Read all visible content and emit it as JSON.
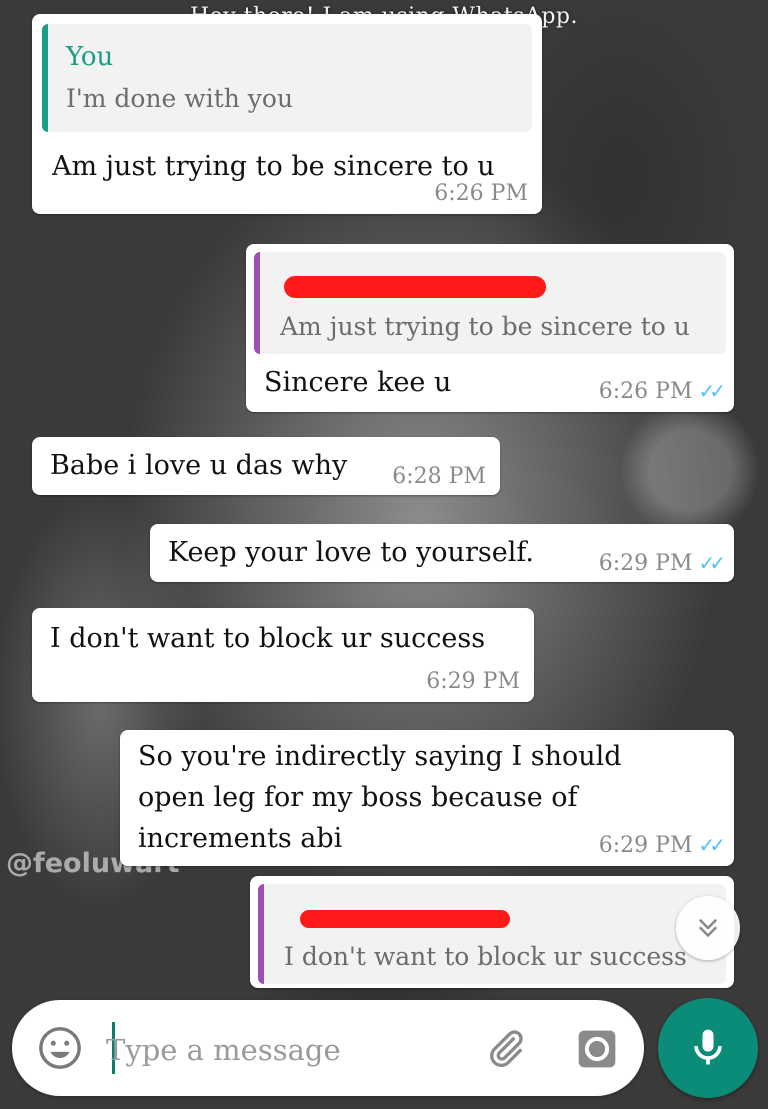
{
  "header": {
    "status": "Hey there! I am using WhatsApp."
  },
  "watermark": "@feoluwart",
  "messages": [
    {
      "direction": "in",
      "quote": {
        "author": "You",
        "text": "I'm done with you"
      },
      "text": "Am just trying to be sincere to u",
      "time": "6:26 PM"
    },
    {
      "direction": "out",
      "quote": {
        "author": "",
        "text": "Am just trying to be sincere to u"
      },
      "text": "Sincere kee u",
      "time": "6:26 PM",
      "status": "read"
    },
    {
      "direction": "in",
      "text": "Babe i love u das why",
      "time": "6:28 PM"
    },
    {
      "direction": "out",
      "text": "Keep your love to yourself.",
      "time": "6:29 PM",
      "status": "read"
    },
    {
      "direction": "in",
      "text": "I don't want to block ur success",
      "time": "6:29 PM"
    },
    {
      "direction": "out",
      "text_lines": [
        "So you're indirectly saying I should",
        "open leg for my boss because of",
        "increments abi"
      ],
      "time": "6:29 PM",
      "status": "read"
    },
    {
      "direction": "out",
      "quote": {
        "author": "",
        "text": "I don't want to block ur success"
      }
    }
  ],
  "ticks": "✓✓",
  "composer": {
    "placeholder": "Type a message"
  },
  "icons": {
    "emoji": "emoji-icon",
    "attach": "paperclip-icon",
    "camera": "camera-icon",
    "mic": "mic-icon",
    "scroll": "chevron-double-down-icon"
  },
  "colors": {
    "accent": "#0b8c78",
    "read_ticks": "#4fc3f7",
    "quote_self": "#1a9e86",
    "quote_other": "#9c4fb5",
    "redaction": "#ff1a1a"
  }
}
